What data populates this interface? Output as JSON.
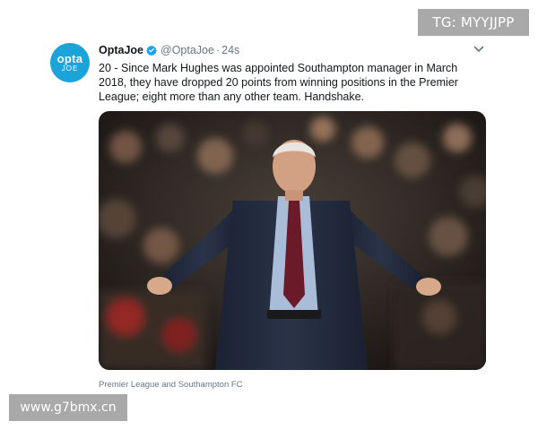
{
  "watermark_top": "TG: MYYJJPP",
  "watermark_bottom": "www.g7bmx.cn",
  "avatar": {
    "line1": "opta",
    "line2": "JOE"
  },
  "tweet": {
    "name": "OptaJoe",
    "handle": "@OptaJoe",
    "separator": "·",
    "time": "24s",
    "text": "20 - Since Mark Hughes was appointed Southampton manager in March 2018, they have dropped 20 points from winning positions in the Premier League; eight more than any other team. Handshake.",
    "photo_caption": "Premier League and Southampton FC"
  },
  "colors": {
    "verified": "#1da1f2",
    "avatar": "#1aa4d9",
    "secondary_text": "#657786"
  },
  "icons": [
    "verified-badge-icon",
    "chevron-down-icon"
  ]
}
